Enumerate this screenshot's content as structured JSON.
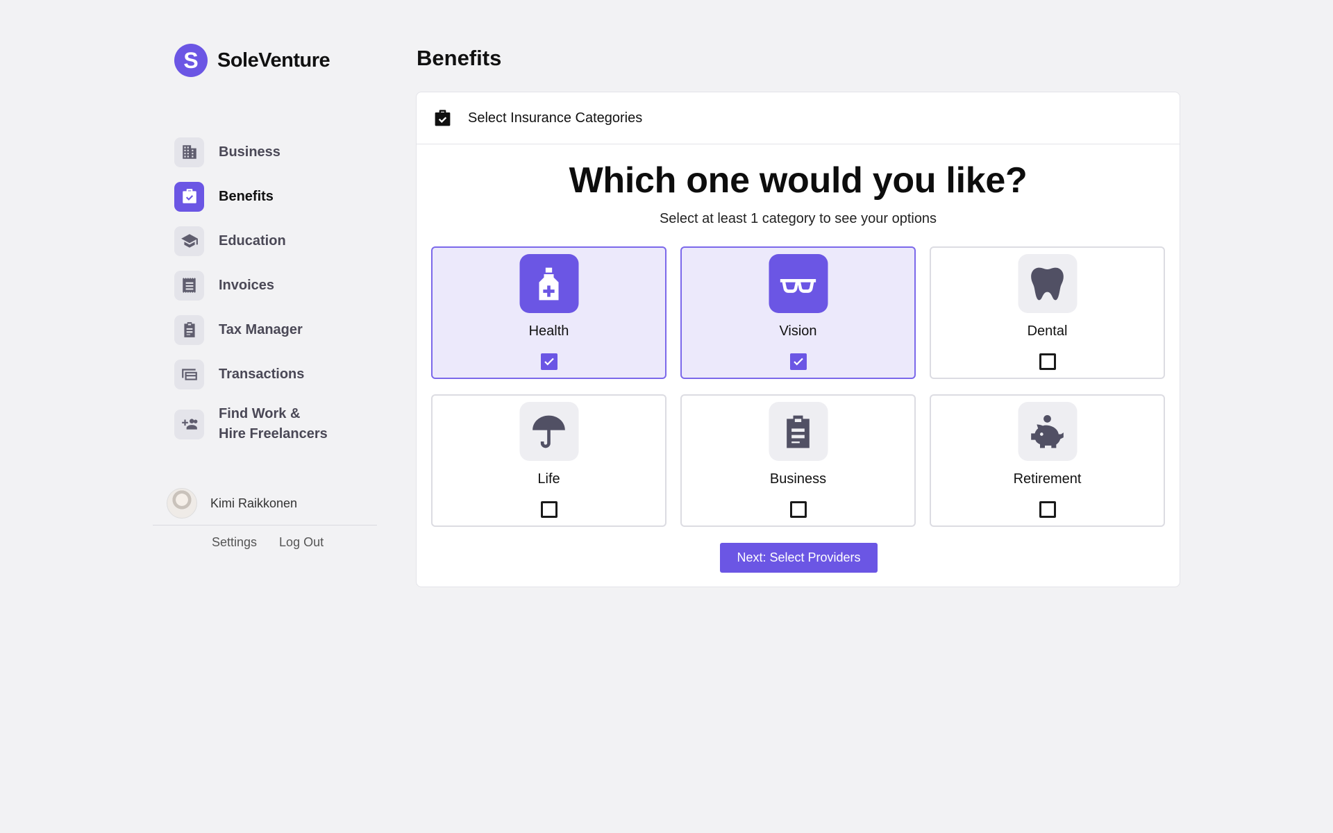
{
  "brand": {
    "logo_letter": "S",
    "name": "SoleVenture",
    "accent": "#6b56e4"
  },
  "sidebar": {
    "items": [
      {
        "label": "Business",
        "icon": "building-icon",
        "active": false
      },
      {
        "label": "Benefits",
        "icon": "briefcase-check-icon",
        "active": true
      },
      {
        "label": "Education",
        "icon": "graduation-cap-icon",
        "active": false
      },
      {
        "label": "Invoices",
        "icon": "receipt-icon",
        "active": false
      },
      {
        "label": "Tax Manager",
        "icon": "clipboard-icon",
        "active": false
      },
      {
        "label": "Transactions",
        "icon": "cards-icon",
        "active": false
      },
      {
        "label_line1": "Find Work &",
        "label_line2": "Hire Freelancers",
        "icon": "add-people-icon",
        "active": false
      }
    ]
  },
  "user": {
    "name": "Kimi Raikkonen",
    "settings_label": "Settings",
    "logout_label": "Log Out"
  },
  "main": {
    "title": "Benefits",
    "card": {
      "header_title": "Select Insurance Categories",
      "header_icon": "briefcase-check-icon",
      "question": "Which one would you like?",
      "subtitle": "Select at least 1 category to see your options",
      "categories": [
        {
          "label": "Health",
          "icon": "medicine-bottle-icon",
          "selected": true
        },
        {
          "label": "Vision",
          "icon": "glasses-icon",
          "selected": true
        },
        {
          "label": "Dental",
          "icon": "tooth-icon",
          "selected": false
        },
        {
          "label": "Life",
          "icon": "umbrella-icon",
          "selected": false
        },
        {
          "label": "Business",
          "icon": "clipboard-icon",
          "selected": false
        },
        {
          "label": "Retirement",
          "icon": "piggy-bank-icon",
          "selected": false
        }
      ],
      "next_button_label": "Next: Select Providers"
    }
  }
}
